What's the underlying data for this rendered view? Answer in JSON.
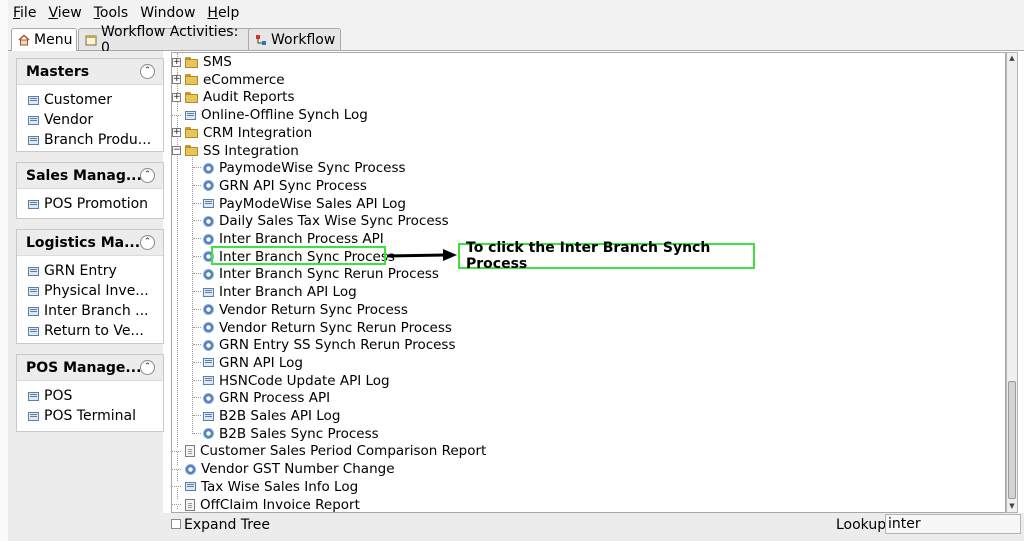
{
  "menubar": [
    {
      "label": "File",
      "key": "F",
      "rest": "ile"
    },
    {
      "label": "View",
      "key": "V",
      "rest": "iew"
    },
    {
      "label": "Tools",
      "key": "T",
      "rest": "ools"
    },
    {
      "label": "Window",
      "key": "",
      "rest": "Window"
    },
    {
      "label": "Help",
      "key": "H",
      "rest": "elp"
    }
  ],
  "tabs": {
    "menu": "Menu",
    "workflow_activities": "Workflow Activities: 0",
    "workflow": "Workflow"
  },
  "sidebar": {
    "sections": [
      {
        "title": "Masters",
        "items": [
          "Customer",
          "Vendor",
          "Branch Produ..."
        ]
      },
      {
        "title": "Sales Manag...",
        "items": [
          "POS Promotion"
        ]
      },
      {
        "title": "Logistics Ma...",
        "items": [
          "GRN Entry",
          "Physical Inve...",
          "Inter Branch ...",
          "Return to Ve..."
        ]
      },
      {
        "title": "POS Manage...",
        "items": [
          "POS",
          "POS Terminal"
        ]
      }
    ]
  },
  "tree": {
    "rows": [
      {
        "label": "SMS",
        "icon": "folder-icon",
        "expander": "+"
      },
      {
        "label": "eCommerce",
        "icon": "folder-icon",
        "expander": "+"
      },
      {
        "label": "Audit Reports",
        "icon": "folder-icon",
        "expander": "+"
      },
      {
        "label": "Online-Offline Synch Log",
        "icon": "document-icon"
      },
      {
        "label": "CRM Integration",
        "icon": "folder-icon",
        "expander": "+"
      },
      {
        "label": "SS Integration",
        "icon": "folder-open-icon",
        "expander": "−"
      },
      {
        "label": "PaymodeWise Sync Process",
        "icon": "gear-icon",
        "child": true
      },
      {
        "label": "GRN API Sync Process",
        "icon": "gear-icon",
        "child": true
      },
      {
        "label": "PayModeWise Sales API Log",
        "icon": "document-icon",
        "child": true
      },
      {
        "label": "Daily Sales Tax Wise Sync Process",
        "icon": "gear-icon",
        "child": true
      },
      {
        "label": "Inter Branch Process API",
        "icon": "gear-icon",
        "child": true
      },
      {
        "label": "Inter Branch Sync Process",
        "icon": "gear-icon",
        "child": true
      },
      {
        "label": "Inter Branch Sync Rerun Process",
        "icon": "gear-icon",
        "child": true
      },
      {
        "label": "Inter Branch API Log",
        "icon": "document-icon",
        "child": true
      },
      {
        "label": "Vendor Return Sync Process",
        "icon": "gear-icon",
        "child": true
      },
      {
        "label": "Vendor Return Sync Rerun Process",
        "icon": "gear-icon",
        "child": true
      },
      {
        "label": "GRN Entry SS Synch Rerun Process",
        "icon": "gear-icon",
        "child": true
      },
      {
        "label": "GRN API Log",
        "icon": "document-icon",
        "child": true
      },
      {
        "label": "HSNCode Update API Log",
        "icon": "document-icon",
        "child": true
      },
      {
        "label": "GRN Process API",
        "icon": "gear-icon",
        "child": true
      },
      {
        "label": "B2B Sales API Log",
        "icon": "document-icon",
        "child": true
      },
      {
        "label": "B2B Sales Sync Process",
        "icon": "gear-icon",
        "child": true
      },
      {
        "label": "Customer Sales Period Comparison Report",
        "icon": "report-icon"
      },
      {
        "label": "Vendor GST Number Change",
        "icon": "gear-icon"
      },
      {
        "label": "Tax Wise Sales Info Log",
        "icon": "document-icon"
      },
      {
        "label": "OffClaim Invoice Report",
        "icon": "report-icon"
      }
    ]
  },
  "bottom": {
    "expand_tree": "Expand Tree",
    "lookup_label": "Lookup",
    "lookup_value": "inter"
  },
  "annotation": {
    "callout": "To click the Inter Branch Synch Process",
    "color": "#3ee23e"
  }
}
